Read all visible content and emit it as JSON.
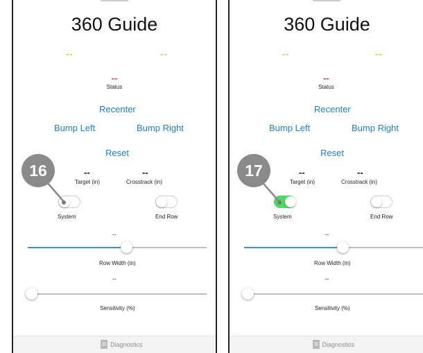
{
  "screens": [
    {
      "title": "360 Guide",
      "top_left_value": "--",
      "top_right_value": "--",
      "status_value": "--",
      "status_label": "Status",
      "recenter_label": "Recenter",
      "bump_left_label": "Bump Left",
      "bump_right_label": "Bump Right",
      "reset_label": "Reset",
      "target_value": "--",
      "target_label": "Target (in)",
      "crosstrack_value": "--",
      "crosstrack_label": "Crosstrack (in)",
      "system_label": "System",
      "system_on": false,
      "end_row_label": "End Row",
      "end_row_on": false,
      "row_width_value": "--",
      "row_width_label": "Row Width (in)",
      "row_width_slider_fraction": 0.55,
      "sensitivity_value": "--",
      "sensitivity_label": "Sensitivity (%)",
      "sensitivity_slider_fraction": 0.0,
      "footer_label": "Diagnostics",
      "callout_number": "16"
    },
    {
      "title": "360 Guide",
      "top_left_value": "--",
      "top_right_value": "--",
      "status_value": "--",
      "status_label": "Status",
      "recenter_label": "Recenter",
      "bump_left_label": "Bump Left",
      "bump_right_label": "Bump Right",
      "reset_label": "Reset",
      "target_value": "--",
      "target_label": "Target (in)",
      "crosstrack_value": "--",
      "crosstrack_label": "Crosstrack (in)",
      "system_label": "System",
      "system_on": true,
      "end_row_label": "End Row",
      "end_row_on": false,
      "row_width_value": "--",
      "row_width_label": "Row Width (in)",
      "row_width_slider_fraction": 0.55,
      "sensitivity_value": "--",
      "sensitivity_label": "Sensitivity (%)",
      "sensitivity_slider_fraction": 0.0,
      "footer_label": "Diagnostics",
      "callout_number": "17"
    }
  ],
  "colors": {
    "link": "#1a7fe0",
    "status_red": "#e23b2e",
    "placeholder_yellow": "#e6c400",
    "toggle_on": "#4cd964",
    "callout": "#8a8a8a"
  },
  "icons": [
    "diagnostics-icon"
  ]
}
